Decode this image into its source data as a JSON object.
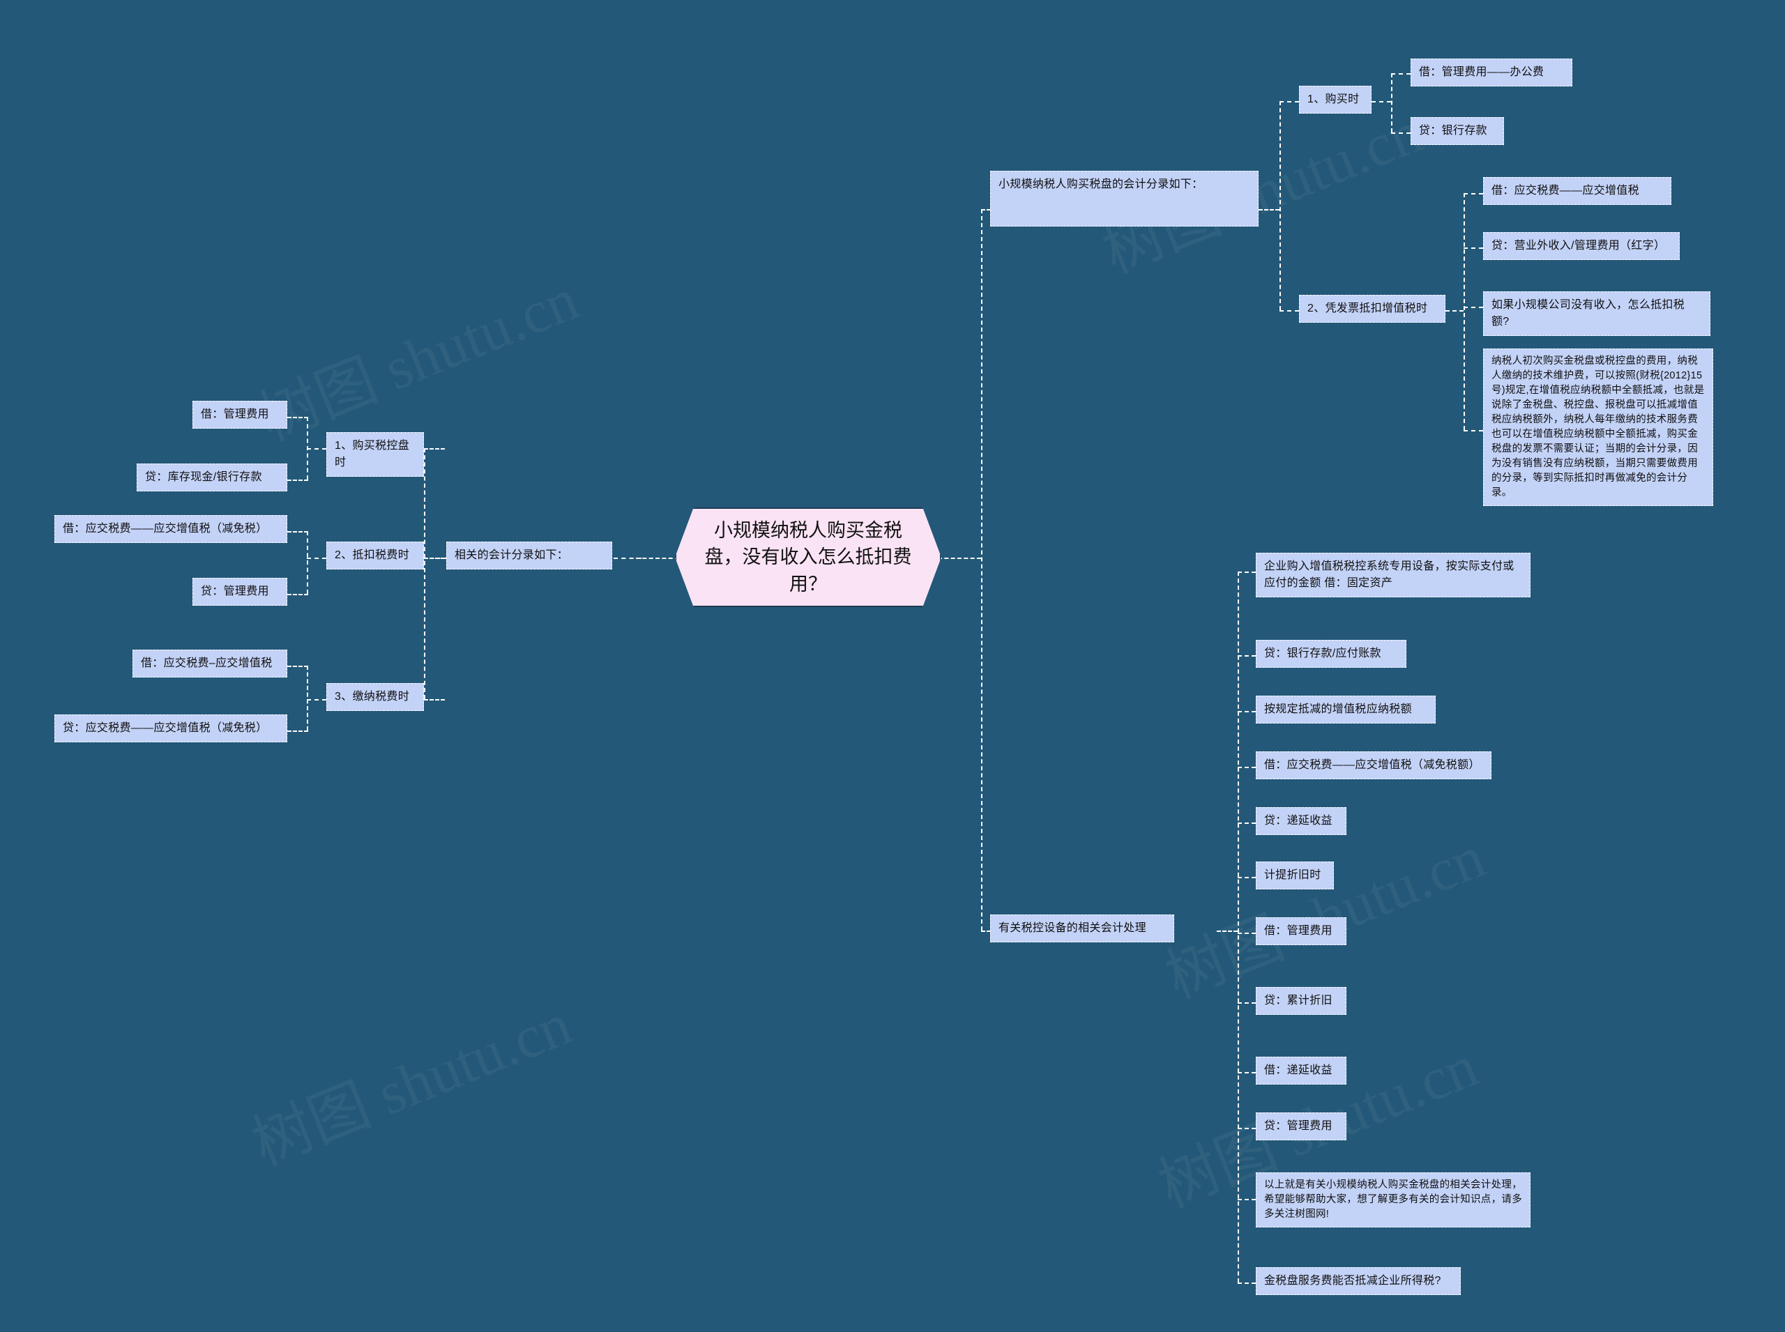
{
  "root": {
    "label": "小规模纳税人购买金税盘，没有收入怎么抵扣费用？"
  },
  "watermarks": [
    "树图 shutu.cn",
    "树图 shutu.cn",
    "树图 shutu.cn",
    "树图 shutu.cn",
    "树图 shutu.cn"
  ],
  "left_branch": {
    "title": "相关的会计分录如下：",
    "groups": [
      {
        "label": "1、购买税控盘时",
        "entries": [
          "借：管理费用",
          "贷：库存现金/银行存款"
        ]
      },
      {
        "label": "2、抵扣税费时",
        "entries": [
          "借：应交税费——应交增值税（减免税）",
          "贷：管理费用"
        ]
      },
      {
        "label": "3、缴纳税费时",
        "entries": [
          "借：应交税费–应交增值税",
          "贷：应交税费——应交增值税（减免税）"
        ]
      }
    ]
  },
  "right_branch_top": {
    "title": "小规模纳税人购买税盘的会计分录如下：",
    "groups": [
      {
        "label": "1、购买时",
        "entries": [
          "借：管理费用——办公费",
          "贷：银行存款"
        ]
      },
      {
        "label": "2、凭发票抵扣增值税时",
        "entries": [
          "借：应交税费——应交增值税",
          "贷：营业外收入/管理费用（红字）"
        ]
      }
    ],
    "question": "如果小规模公司没有收入，怎么抵扣税额?",
    "answer": "纳税人初次购买金税盘或税控盘的费用，纳税人缴纳的技术维护费，可以按照(财税{2012}15号)规定,在增值税应纳税额中全额抵减，也就是说除了金税盘、税控盘、报税盘可以抵减增值税应纳税额外，纳税人每年缴纳的技术服务费也可以在增值税应纳税额中全额抵减，购买金税盘的发票不需要认证；当期的会计分录，因为没有销售没有应纳税额，当期只需要做费用的分录，等到实际抵扣时再做减免的会计分录。"
  },
  "right_branch_bottom": {
    "title": "有关税控设备的相关会计处理",
    "items": [
      "企业购入增值税税控系统专用设备，按实际支付或应付的金额        借：固定资产",
      "贷：银行存款/应付账款",
      "按规定抵减的增值税应纳税额",
      "借：应交税费——应交增值税（减免税额）",
      "贷：递延收益",
      "计提折旧时",
      "借：管理费用",
      "贷：累计折旧",
      "借：递延收益",
      "贷：管理费用",
      "以上就是有关小规模纳税人购买金税盘的相关会计处理，希望能够帮助大家，想了解更多有关的会计知识点，请多多关注树图网!",
      "金税盘服务费能否抵减企业所得税?"
    ]
  },
  "colors": {
    "background": "#235878",
    "node_fill": "#c3d2f7",
    "root_fill": "#fae3f5",
    "root_border": "#1b3a52",
    "connector": "#ffffff"
  }
}
